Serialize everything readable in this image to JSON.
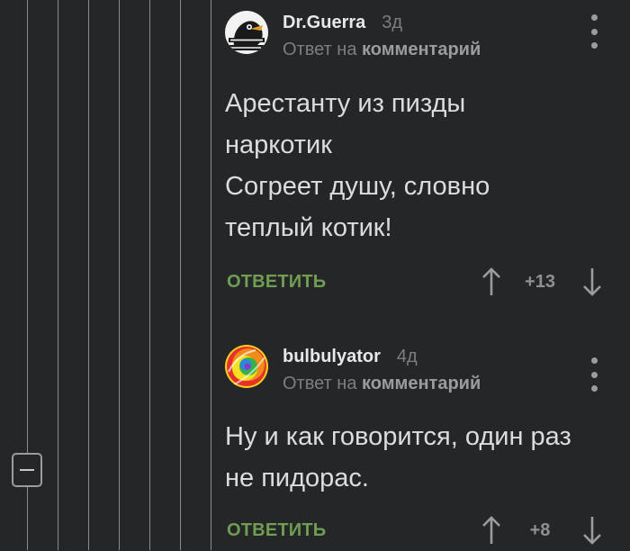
{
  "comments": [
    {
      "author": "Dr.Guerra",
      "time": "3д",
      "reply_prefix": "Ответ на",
      "reply_link": "комментарий",
      "body": [
        "Арестанту из пизды",
        "наркотик",
        "Согреет душу, словно",
        "теплый котик!"
      ],
      "reply_label": "ОТВЕТИТЬ",
      "rating": "+13",
      "avatar_icon": "duck-avatar-icon"
    },
    {
      "author": "bulbulyator",
      "time": "4д",
      "reply_prefix": "Ответ на",
      "reply_link": "комментарий",
      "body": [
        "Ну и как говорится, один раз",
        "не пидорас."
      ],
      "reply_label": "ОТВЕТИТЬ",
      "rating": "+8",
      "avatar_icon": "rainbow-swirl-avatar-icon"
    }
  ],
  "colors": {
    "background": "#242628",
    "reply_green": "#6f9d52",
    "muted_text": "#7c7e80",
    "body_text": "#dcdcdc"
  }
}
